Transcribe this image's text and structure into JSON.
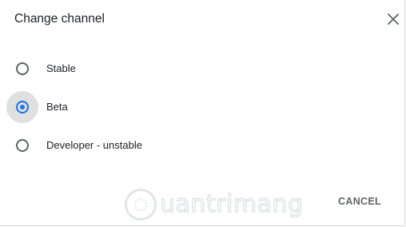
{
  "dialog": {
    "title": "Change channel",
    "close_icon": "close-icon",
    "options": [
      {
        "label": "Stable",
        "selected": false
      },
      {
        "label": "Beta",
        "selected": true
      },
      {
        "label": "Developer - unstable",
        "selected": false
      }
    ],
    "cancel_label": "CANCEL"
  },
  "watermark": {
    "text": "uantrimang",
    "logo_icon": "quantrimang-logo-icon"
  },
  "colors": {
    "accent": "#1a73e8",
    "text": "#202124",
    "secondary_text": "#5f6368",
    "selected_halo": "#e0e0e0"
  }
}
